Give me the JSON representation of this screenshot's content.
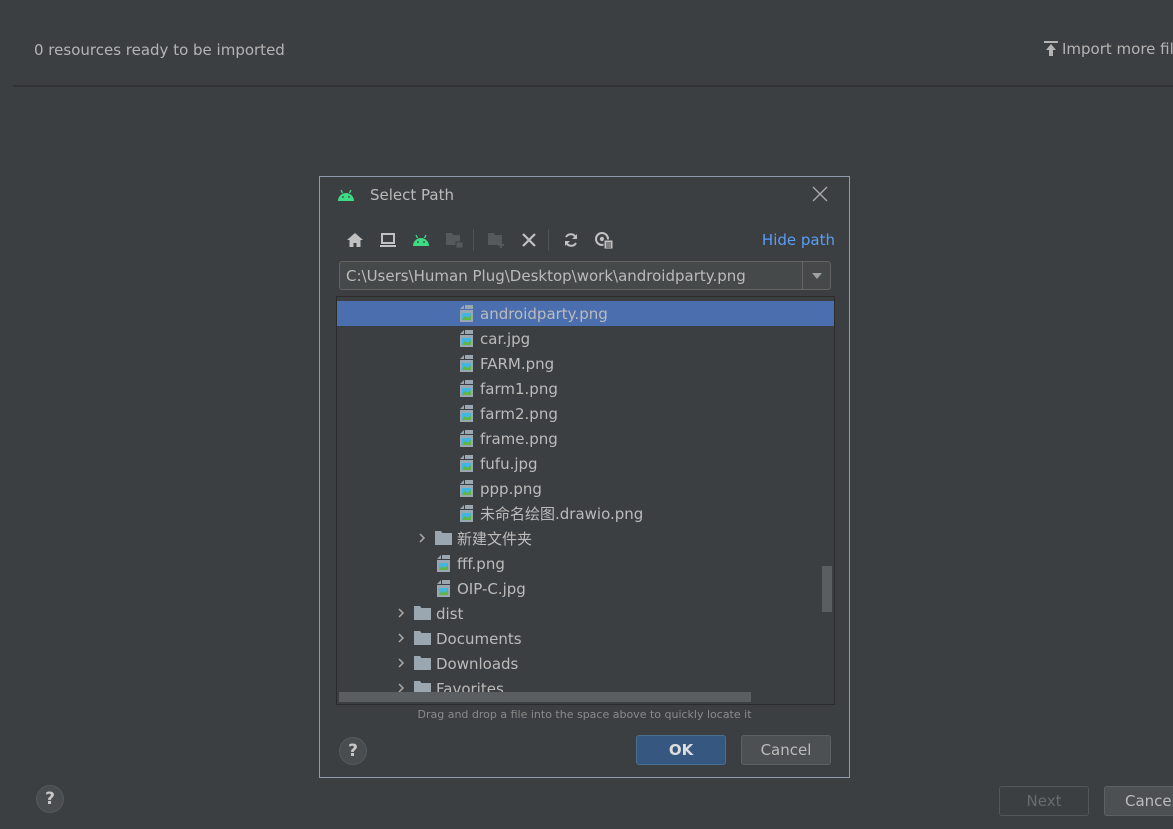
{
  "background_page": {
    "status_text": "0 resources ready to be imported",
    "import_more_label": "Import more files",
    "import_icon": "upload-icon",
    "help_label": "?",
    "next_label": "Next",
    "cancel_label": "Cancel",
    "next_enabled": false
  },
  "dialog": {
    "title": "Select Path",
    "title_icon": "android-icon",
    "close_icon": "close-icon",
    "toolbar": [
      {
        "name": "home-icon",
        "enabled": true
      },
      {
        "name": "desktop-icon",
        "enabled": true
      },
      {
        "name": "android-project-icon",
        "enabled": true
      },
      {
        "name": "module-folder-icon",
        "enabled": false
      },
      {
        "name": "new-folder-icon",
        "enabled": false
      },
      {
        "name": "delete-icon",
        "enabled": true
      },
      {
        "name": "refresh-icon",
        "enabled": true
      },
      {
        "name": "show-hidden-icon",
        "enabled": true
      }
    ],
    "hide_path_label": "Hide path",
    "path_value": "C:\\Users\\Human Plug\\Desktop\\work\\androidparty.png",
    "tree": [
      {
        "label": "androidparty.png",
        "type": "image-file",
        "depth": 3,
        "selected": true
      },
      {
        "label": "car.jpg",
        "type": "image-file",
        "depth": 3
      },
      {
        "label": "FARM.png",
        "type": "image-file",
        "depth": 3
      },
      {
        "label": "farm1.png",
        "type": "image-file",
        "depth": 3
      },
      {
        "label": "farm2.png",
        "type": "image-file",
        "depth": 3
      },
      {
        "label": "frame.png",
        "type": "image-file",
        "depth": 3
      },
      {
        "label": "fufu.jpg",
        "type": "image-file",
        "depth": 3
      },
      {
        "label": "ppp.png",
        "type": "image-file",
        "depth": 3
      },
      {
        "label": "未命名绘图.drawio.png",
        "type": "image-file",
        "depth": 3
      },
      {
        "label": "新建文件夹",
        "type": "folder",
        "depth": 2,
        "expandable": true
      },
      {
        "label": "fff.png",
        "type": "image-file",
        "depth": 2
      },
      {
        "label": "OIP-C.jpg",
        "type": "image-file",
        "depth": 2
      },
      {
        "label": "dist",
        "type": "folder",
        "depth": 1,
        "expandable": true
      },
      {
        "label": "Documents",
        "type": "folder",
        "depth": 1,
        "expandable": true
      },
      {
        "label": "Downloads",
        "type": "folder",
        "depth": 1,
        "expandable": true
      },
      {
        "label": "Favorites",
        "type": "folder",
        "depth": 1,
        "expandable": true
      }
    ],
    "hint": "Drag and drop a file into the space above to quickly locate it",
    "help_label": "?",
    "ok_label": "OK",
    "cancel_label": "Cancel"
  },
  "colors": {
    "background": "#3c3f41",
    "selection": "#4b6eaf",
    "link": "#589df6",
    "android_green": "#3ddc84",
    "ok_button": "#365880"
  }
}
